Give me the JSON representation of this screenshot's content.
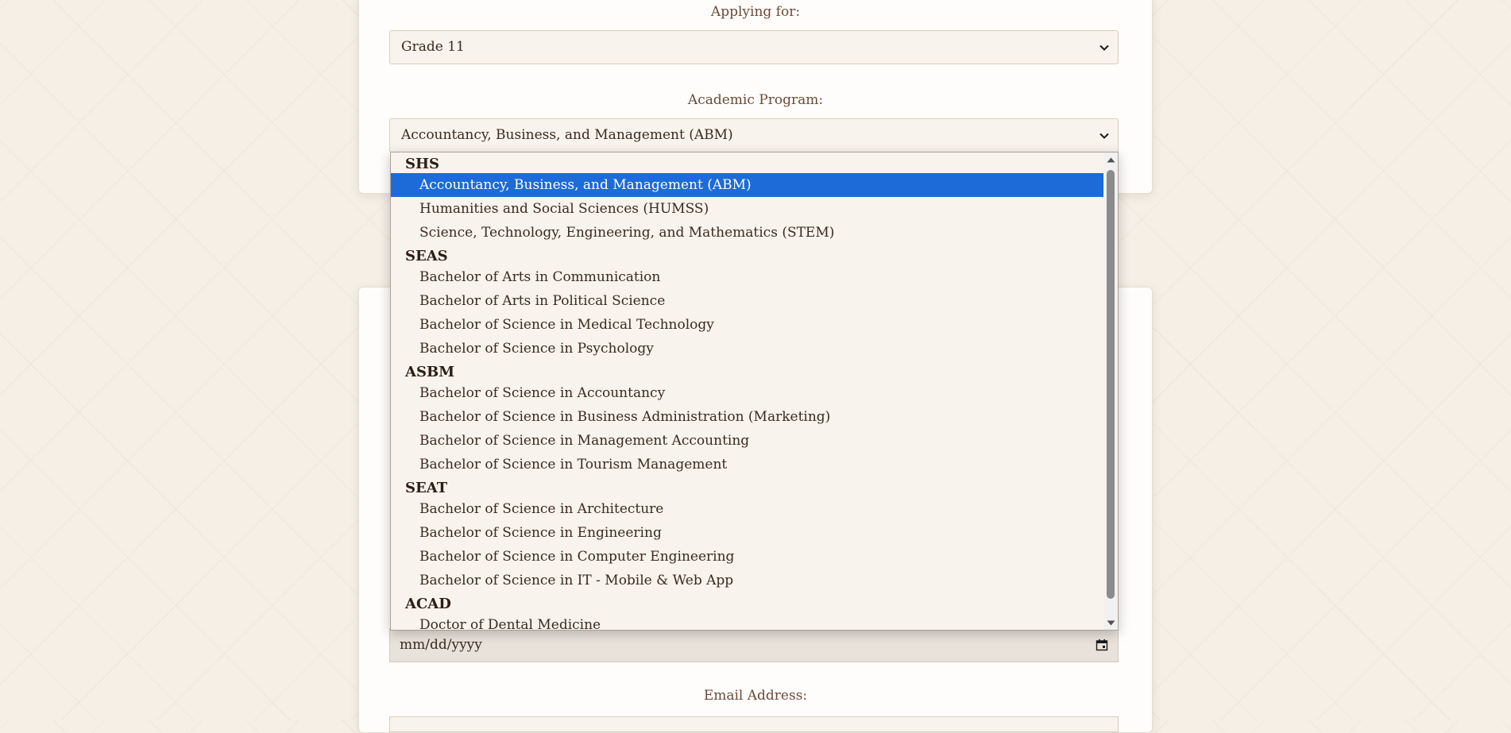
{
  "form": {
    "applying_for_label": "Applying for:",
    "applying_for_value": "Grade 11",
    "academic_program_label": "Academic Program:",
    "academic_program_value": "Accountancy, Business, and Management (ABM)",
    "birthdate_placeholder": "mm/dd/yyyy",
    "email_label": "Email Address:"
  },
  "dropdown": {
    "selected": "Accountancy, Business, and Management (ABM)",
    "groups": [
      {
        "label": "SHS",
        "options": [
          "Accountancy, Business, and Management (ABM)",
          "Humanities and Social Sciences (HUMSS)",
          "Science, Technology, Engineering, and Mathematics (STEM)"
        ]
      },
      {
        "label": "SEAS",
        "options": [
          "Bachelor of Arts in Communication",
          "Bachelor of Arts in Political Science",
          "Bachelor of Science in Medical Technology",
          "Bachelor of Science in Psychology"
        ]
      },
      {
        "label": "ASBM",
        "options": [
          "Bachelor of Science in Accountancy",
          "Bachelor of Science in Business Administration (Marketing)",
          "Bachelor of Science in Management Accounting",
          "Bachelor of Science in Tourism Management"
        ]
      },
      {
        "label": "SEAT",
        "options": [
          "Bachelor of Science in Architecture",
          "Bachelor of Science in Engineering",
          "Bachelor of Science in Computer Engineering",
          "Bachelor of Science in IT - Mobile & Web App"
        ]
      },
      {
        "label": "ACAD",
        "options": [
          "Doctor of Dental Medicine"
        ]
      }
    ]
  },
  "icons": {
    "select_chevron": "chevron-down-icon",
    "calendar": "calendar-icon",
    "scroll_up": "scroll-up-arrow-icon",
    "scroll_down": "scroll-down-arrow-icon"
  }
}
